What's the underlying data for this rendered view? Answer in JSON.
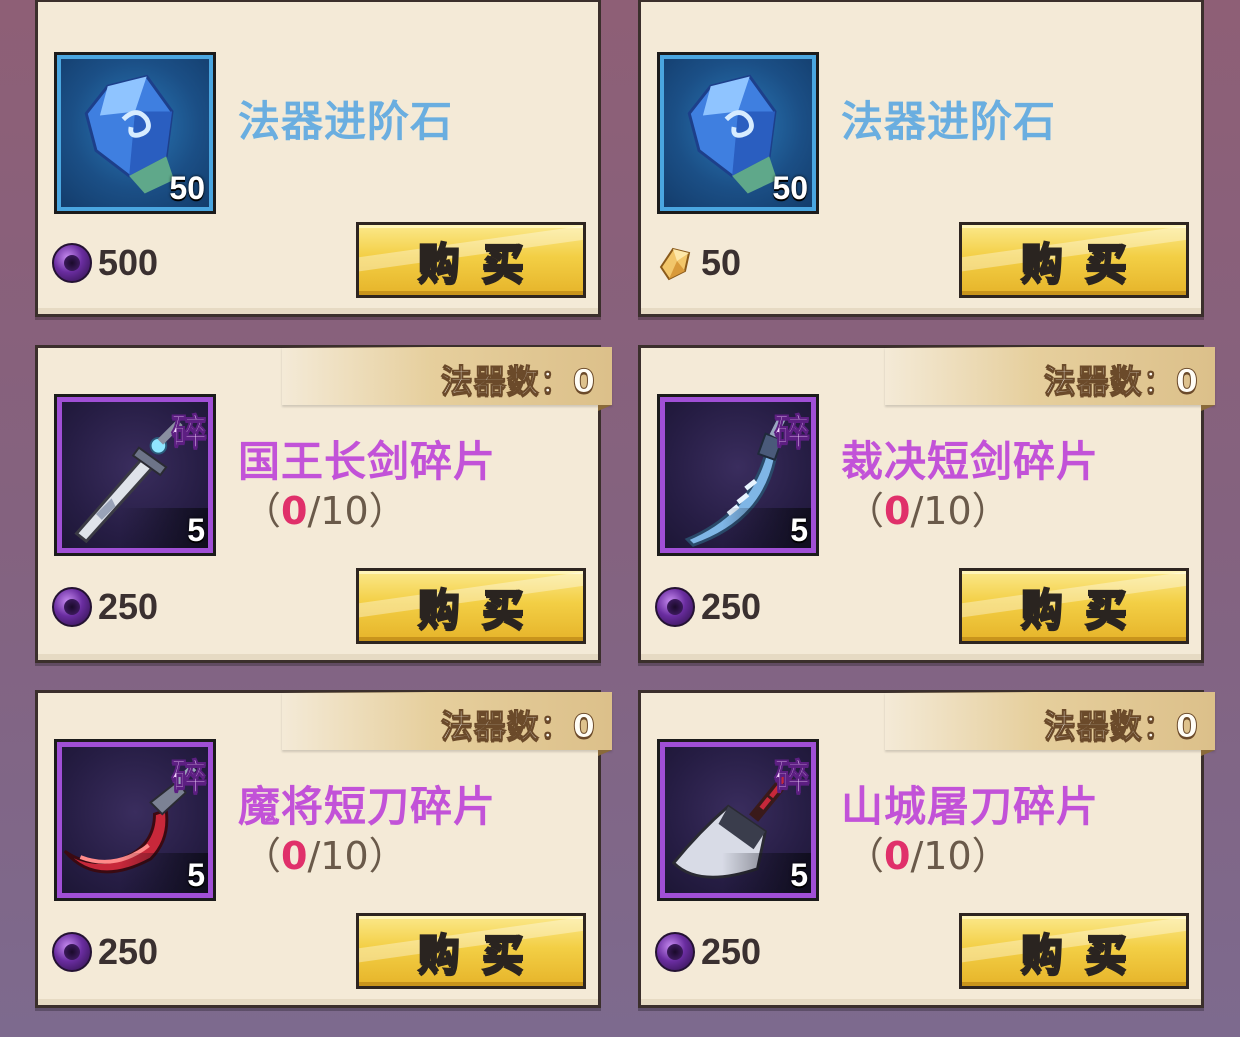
{
  "colors": {
    "card_bg": "#f4ead7",
    "rare_blue": "#6aaee0",
    "epic_purple": "#c252d8",
    "progress_current": "#e0306a",
    "button_gold": "#f3cf45"
  },
  "shop_items": [
    {
      "name": "法器进阶石",
      "quantity": "50",
      "rarity": "blue",
      "icon": "blue-crystal-icon",
      "currency_icon": "purple-orb-icon",
      "price": "500",
      "buy_label": "购买"
    },
    {
      "name": "法器进阶石",
      "quantity": "50",
      "rarity": "blue",
      "icon": "blue-crystal-icon",
      "currency_icon": "gold-diamond-icon",
      "price": "50",
      "buy_label": "购买"
    },
    {
      "name": "国王长剑碎片",
      "owned_label": "法器数：0",
      "shard_tag": "碎",
      "quantity": "5",
      "progress_open": "（",
      "progress_current": "0",
      "progress_rest": "/10）",
      "rarity": "purple",
      "icon": "long-sword-icon",
      "currency_icon": "purple-orb-icon",
      "price": "250",
      "buy_label": "购买"
    },
    {
      "name": "裁决短剑碎片",
      "owned_label": "法器数：0",
      "shard_tag": "碎",
      "quantity": "5",
      "progress_open": "（",
      "progress_current": "0",
      "progress_rest": "/10）",
      "rarity": "purple",
      "icon": "short-sword-icon",
      "currency_icon": "purple-orb-icon",
      "price": "250",
      "buy_label": "购买"
    },
    {
      "name": "魔将短刀碎片",
      "owned_label": "法器数：0",
      "shard_tag": "碎",
      "quantity": "5",
      "progress_open": "（",
      "progress_current": "0",
      "progress_rest": "/10）",
      "rarity": "purple",
      "icon": "curved-blade-icon",
      "currency_icon": "purple-orb-icon",
      "price": "250",
      "buy_label": "购买"
    },
    {
      "name": "山城屠刀碎片",
      "owned_label": "法器数：0",
      "shard_tag": "碎",
      "quantity": "5",
      "progress_open": "（",
      "progress_current": "0",
      "progress_rest": "/10）",
      "rarity": "purple",
      "icon": "cleaver-icon",
      "currency_icon": "purple-orb-icon",
      "price": "250",
      "buy_label": "购买"
    }
  ]
}
